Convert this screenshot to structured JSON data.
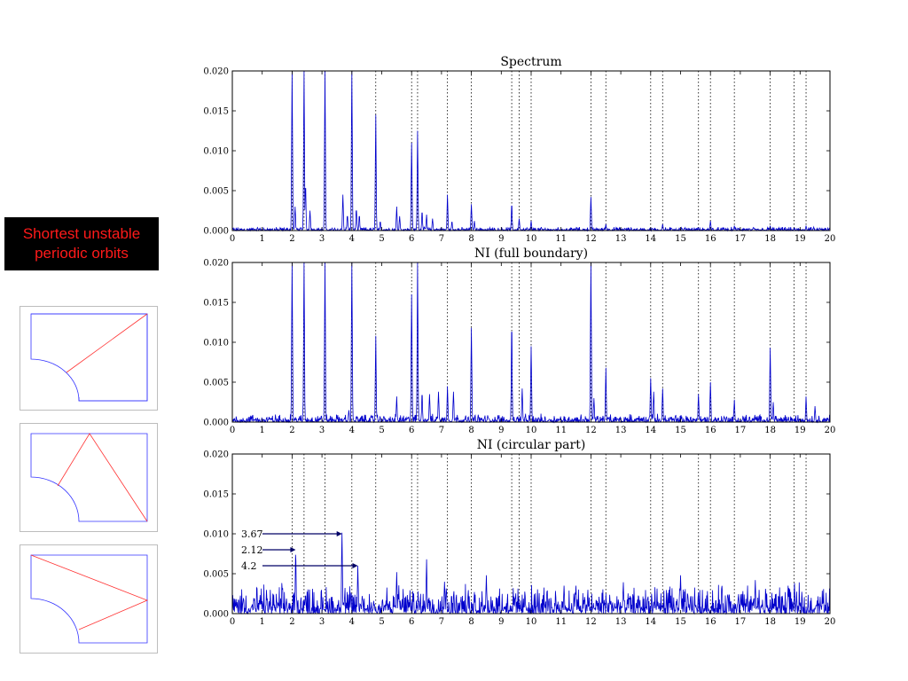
{
  "sidebar": {
    "label_text": "Shortest unstable\nperiodic orbits",
    "label_color": "#ff1a1a",
    "thumbnails": [
      {
        "name": "orbit-thumbnail-1",
        "orbit_color": "#ff3333",
        "boundary_color": "#3333ff"
      },
      {
        "name": "orbit-thumbnail-2",
        "orbit_color": "#ff3333",
        "boundary_color": "#3333ff"
      },
      {
        "name": "orbit-thumbnail-3",
        "orbit_color": "#ff3333",
        "boundary_color": "#3333ff"
      }
    ]
  },
  "chart_data": [
    {
      "type": "line",
      "title": "Spectrum",
      "xlabel": "",
      "ylabel": "",
      "xlim": [
        0,
        20
      ],
      "ylim": [
        0,
        0.02
      ],
      "xticks": [
        "0",
        "1",
        "2",
        "3",
        "4",
        "5",
        "6",
        "7",
        "8",
        "9",
        "10",
        "11",
        "12",
        "13",
        "14",
        "15",
        "16",
        "17",
        "18",
        "19",
        "20"
      ],
      "yticks": [
        "0.000",
        "0.005",
        "0.010",
        "0.015",
        "0.020"
      ],
      "reference_lines": [
        2.0,
        2.4,
        3.1,
        4.0,
        4.8,
        6.0,
        6.2,
        7.2,
        8.0,
        9.35,
        9.6,
        10.0,
        12.0,
        12.5,
        14.0,
        14.4,
        15.6,
        16.0,
        16.8,
        18.0,
        18.8,
        19.2
      ],
      "color": "#0000cc",
      "peaks": [
        [
          2.0,
          0.02
        ],
        [
          2.1,
          0.003
        ],
        [
          2.4,
          0.02
        ],
        [
          2.45,
          0.006
        ],
        [
          2.6,
          0.0025
        ],
        [
          3.1,
          0.02
        ],
        [
          3.7,
          0.0045
        ],
        [
          3.85,
          0.002
        ],
        [
          4.0,
          0.02
        ],
        [
          4.15,
          0.0028
        ],
        [
          4.25,
          0.002
        ],
        [
          4.8,
          0.0145
        ],
        [
          4.95,
          0.0012
        ],
        [
          5.5,
          0.003
        ],
        [
          5.6,
          0.0018
        ],
        [
          6.0,
          0.011
        ],
        [
          6.2,
          0.0125
        ],
        [
          6.35,
          0.0025
        ],
        [
          6.5,
          0.002
        ],
        [
          6.7,
          0.0015
        ],
        [
          7.2,
          0.0045
        ],
        [
          7.35,
          0.0012
        ],
        [
          8.0,
          0.0033
        ],
        [
          8.1,
          0.0012
        ],
        [
          9.35,
          0.0035
        ],
        [
          9.6,
          0.0015
        ],
        [
          10.0,
          0.0012
        ],
        [
          12.0,
          0.0042
        ],
        [
          12.5,
          0.0008
        ],
        [
          14.4,
          0.0008
        ],
        [
          16.0,
          0.0012
        ],
        [
          16.8,
          0.0006
        ],
        [
          18.0,
          0.0006
        ],
        [
          19.2,
          0.0006
        ]
      ],
      "noise_level": 0.0003
    },
    {
      "type": "line",
      "title": "NI (full boundary)",
      "xlabel": "",
      "ylabel": "",
      "xlim": [
        0,
        20
      ],
      "ylim": [
        0,
        0.02
      ],
      "xticks": [
        "0",
        "1",
        "2",
        "3",
        "4",
        "5",
        "6",
        "7",
        "8",
        "9",
        "10",
        "11",
        "12",
        "13",
        "14",
        "15",
        "16",
        "17",
        "18",
        "19",
        "20"
      ],
      "yticks": [
        "0.000",
        "0.005",
        "0.010",
        "0.015",
        "0.020"
      ],
      "reference_lines": [
        2.0,
        2.4,
        3.1,
        4.0,
        4.8,
        6.0,
        6.2,
        7.2,
        8.0,
        9.35,
        9.6,
        10.0,
        12.0,
        12.5,
        14.0,
        14.4,
        15.6,
        16.0,
        16.8,
        18.0,
        18.8,
        19.2
      ],
      "color": "#0000cc",
      "peaks": [
        [
          2.0,
          0.02
        ],
        [
          2.4,
          0.02
        ],
        [
          3.1,
          0.02
        ],
        [
          3.9,
          0.0015
        ],
        [
          4.0,
          0.02
        ],
        [
          4.8,
          0.0108
        ],
        [
          5.5,
          0.0032
        ],
        [
          6.0,
          0.016
        ],
        [
          6.2,
          0.02
        ],
        [
          6.35,
          0.0038
        ],
        [
          6.6,
          0.0035
        ],
        [
          6.9,
          0.0038
        ],
        [
          7.2,
          0.0045
        ],
        [
          7.4,
          0.0038
        ],
        [
          8.0,
          0.0118
        ],
        [
          9.35,
          0.0128
        ],
        [
          9.7,
          0.0042
        ],
        [
          10.0,
          0.0095
        ],
        [
          12.0,
          0.02
        ],
        [
          12.1,
          0.003
        ],
        [
          12.5,
          0.0068
        ],
        [
          14.0,
          0.0055
        ],
        [
          14.1,
          0.0038
        ],
        [
          14.4,
          0.0042
        ],
        [
          15.6,
          0.0035
        ],
        [
          16.0,
          0.005
        ],
        [
          16.8,
          0.0028
        ],
        [
          18.0,
          0.0093
        ],
        [
          18.1,
          0.0025
        ],
        [
          19.2,
          0.0032
        ],
        [
          19.5,
          0.002
        ]
      ],
      "noise_level": 0.0007
    },
    {
      "type": "line",
      "title": "NI (circular part)",
      "xlabel": "",
      "ylabel": "",
      "xlim": [
        0,
        20
      ],
      "ylim": [
        0,
        0.02
      ],
      "xticks": [
        "0",
        "1",
        "2",
        "3",
        "4",
        "5",
        "6",
        "7",
        "8",
        "9",
        "10",
        "11",
        "12",
        "13",
        "14",
        "15",
        "16",
        "17",
        "18",
        "19",
        "20"
      ],
      "yticks": [
        "0.000",
        "0.005",
        "0.010",
        "0.015",
        "0.020"
      ],
      "reference_lines": [
        2.0,
        2.4,
        3.1,
        4.0,
        4.8,
        6.0,
        6.2,
        7.2,
        8.0,
        9.35,
        9.6,
        10.0,
        12.0,
        12.5,
        14.0,
        14.4,
        15.6,
        16.0,
        16.8,
        18.0,
        18.8,
        19.2
      ],
      "color": "#0000cc",
      "peaks": [
        [
          2.12,
          0.008
        ],
        [
          2.45,
          0.0025
        ],
        [
          3.67,
          0.0102
        ],
        [
          4.2,
          0.006
        ],
        [
          5.5,
          0.0052
        ],
        [
          6.5,
          0.0068
        ],
        [
          7.1,
          0.004
        ],
        [
          8.5,
          0.0048
        ],
        [
          11.1,
          0.0035
        ],
        [
          11.5,
          0.0035
        ],
        [
          15.0,
          0.0048
        ],
        [
          17.5,
          0.0042
        ],
        [
          18.6,
          0.0035
        ]
      ],
      "noise_level": 0.0025,
      "annotations": [
        {
          "text": "3.67",
          "x": 3.67,
          "y": 0.01
        },
        {
          "text": "2.12",
          "x": 2.12,
          "y": 0.008
        },
        {
          "text": "4.2",
          "x": 4.2,
          "y": 0.006
        }
      ]
    }
  ]
}
